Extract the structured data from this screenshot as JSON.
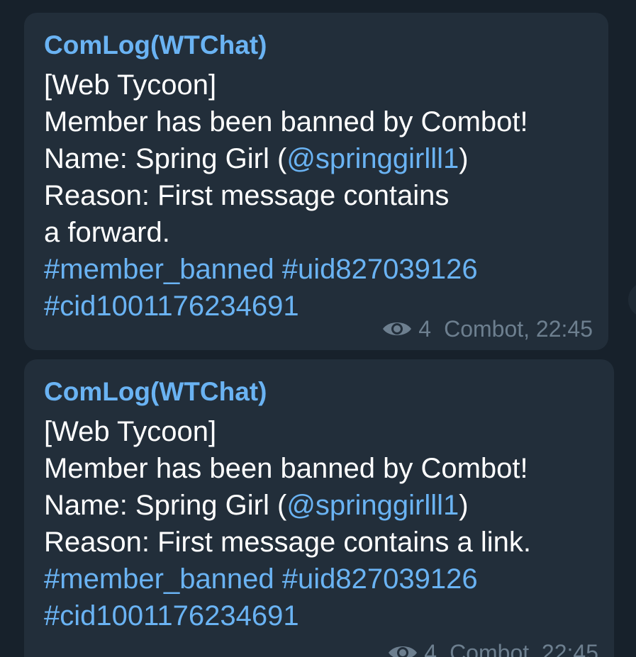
{
  "messages": [
    {
      "sender": "ComLog(WTChat)",
      "line1": "[Web Tycoon]",
      "line2": "Member has been banned by Combot!",
      "name_prefix": "Name: Spring Girl (",
      "name_username": "@springgirlll1",
      "name_suffix": ")",
      "reason_line1": "Reason: First message contains",
      "reason_line2": "a forward.",
      "tag_banned": "#member_banned",
      "tag_uid": "#uid827039126",
      "tag_cid": "#cid1001176234691",
      "views": "4",
      "signature": "Combot, 22:45"
    },
    {
      "sender": "ComLog(WTChat)",
      "line1": "[Web Tycoon]",
      "line2": "Member has been banned by Combot!",
      "name_prefix": "Name: Spring Girl (",
      "name_username": "@springgirlll1",
      "name_suffix": ")",
      "reason_line1": "Reason: First message contains a link.",
      "tag_banned": "#member_banned",
      "tag_uid": "#uid827039126",
      "tag_cid": "#cid1001176234691",
      "views": "4",
      "signature": "Combot, 22:45"
    }
  ],
  "colors": {
    "background": "#17212b",
    "bubble": "#222e3a",
    "link": "#6ab3f3",
    "meta": "#6d7f8f",
    "text": "#ffffff"
  },
  "icons": {
    "views": "eye-icon"
  }
}
